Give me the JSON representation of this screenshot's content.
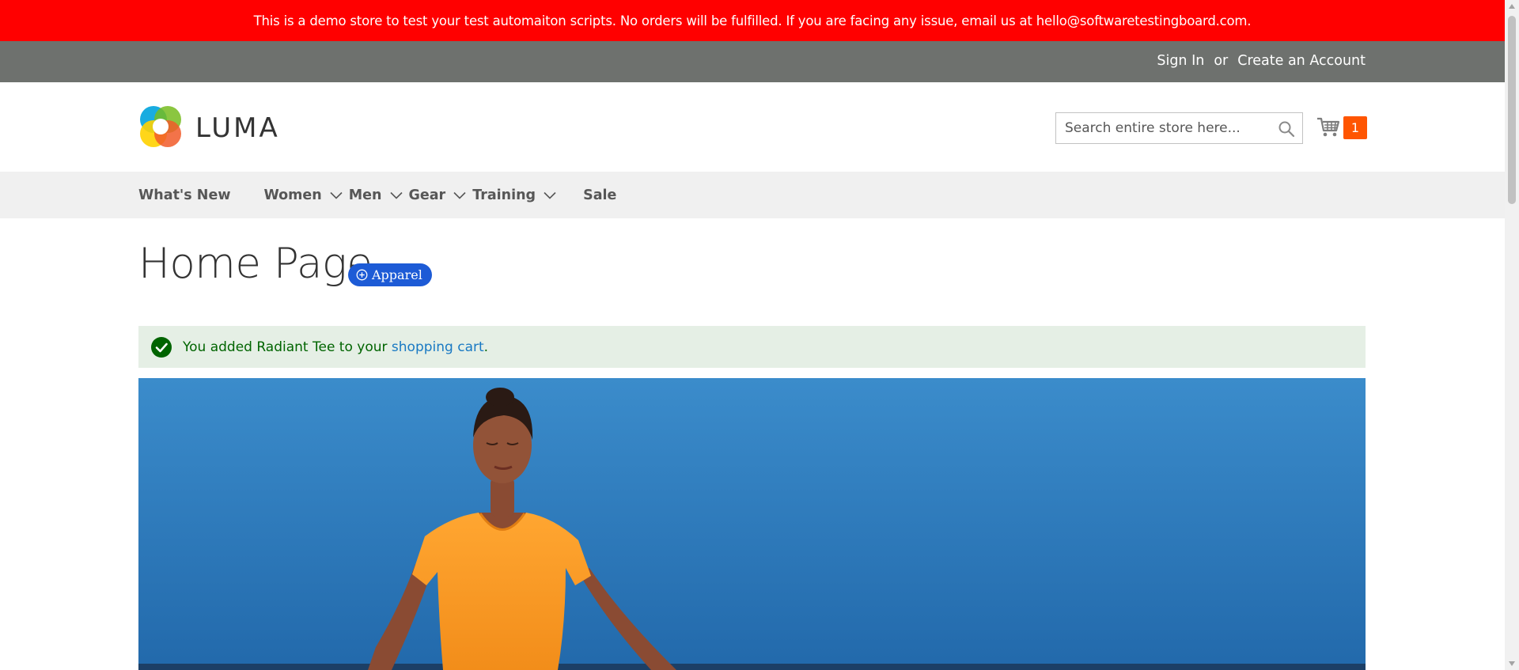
{
  "demo_notice": "This is a demo store to test your test automaiton scripts. No orders will be fulfilled. If you are facing any issue, email us at hello@softwaretestingboard.com.",
  "header_links": {
    "sign_in": "Sign In",
    "separator": "or",
    "create_account": "Create an Account"
  },
  "logo": {
    "text": "LUMA",
    "icon": "luma-logo-icon"
  },
  "search": {
    "placeholder": "Search entire store here...",
    "value": "",
    "icon": "search-icon"
  },
  "cart": {
    "icon": "cart-icon",
    "count": "1"
  },
  "nav": {
    "items": [
      {
        "label": "What's New",
        "has_dropdown": false
      },
      {
        "label": "Women",
        "has_dropdown": true
      },
      {
        "label": "Men",
        "has_dropdown": true
      },
      {
        "label": "Gear",
        "has_dropdown": true
      },
      {
        "label": "Training",
        "has_dropdown": true
      },
      {
        "label": "Sale",
        "has_dropdown": false
      }
    ]
  },
  "page": {
    "title": "Home Page",
    "badge": {
      "label": "Apparel",
      "icon": "plus-circle-icon"
    }
  },
  "message": {
    "icon": "check-circle-icon",
    "prefix": "You added Radiant Tee to your ",
    "link": "shopping cart",
    "suffix": "."
  },
  "hero": {
    "image": "woman-meditating-orange-top-blue-sky"
  },
  "colors": {
    "demo_bar": "#ff0000",
    "top_links_bar": "#6e716e",
    "nav_bg": "#f0f0f0",
    "cart_counter": "#ff5501",
    "badge": "#1d5bd6",
    "message_bg": "#e5efe5",
    "message_text": "#006400",
    "link": "#1979c3"
  }
}
